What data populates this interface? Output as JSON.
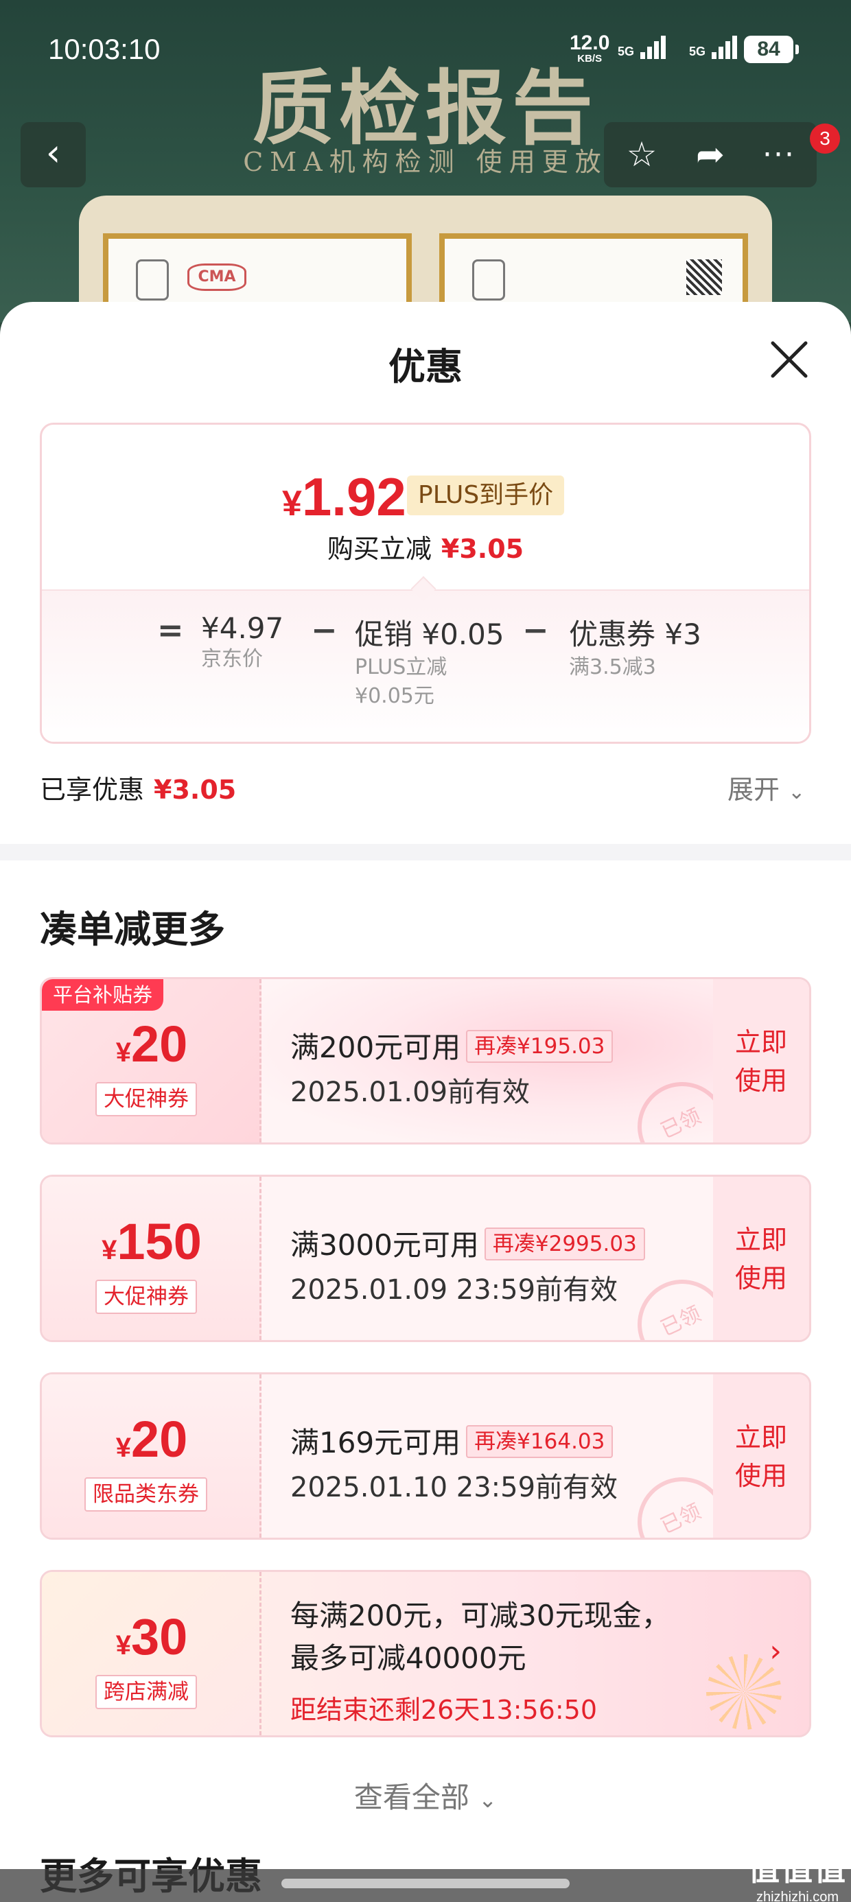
{
  "status_bar": {
    "time": "10:03:10",
    "net_speed": "12.0",
    "net_unit": "KB/S",
    "sig1": "5G",
    "sig2": "5G",
    "battery": "84"
  },
  "banner": {
    "title": "质检报告",
    "subtitle": "CMA机构检测 使用更放",
    "cert_mark": "CMA"
  },
  "nav": {
    "cart_badge": "3"
  },
  "sheet": {
    "title": "优惠"
  },
  "price_card": {
    "currency": "¥",
    "final_price": "1.92",
    "plus_label": "PLUS到手价",
    "instant_label": "购买立减",
    "instant_value": "¥3.05",
    "eq": "=",
    "minus": "−",
    "jd_price": "¥4.97",
    "jd_label": "京东价",
    "promo_value": "促销 ¥0.05",
    "promo_sub1": "PLUS立减",
    "promo_sub2": "¥0.05元",
    "coupon_value": "优惠券 ¥3",
    "coupon_sub": "满3.5减3"
  },
  "enjoyed": {
    "label": "已享优惠",
    "value": "¥3.05",
    "expand": "展开"
  },
  "section": {
    "title": "凑单减更多"
  },
  "coupons": [
    {
      "corner": "平台补贴券",
      "currency": "¥",
      "amount": "20",
      "tag": "大促神券",
      "cond": "满200元可用",
      "chip": "再凑¥195.03",
      "date": "2025.01.09前有效",
      "use": "立即\n使用",
      "stamp": "已领"
    },
    {
      "currency": "¥",
      "amount": "150",
      "tag": "大促神券",
      "cond": "满3000元可用",
      "chip": "再凑¥2995.03",
      "date": "2025.01.09 23:59前有效",
      "use": "立即\n使用",
      "stamp": "已领"
    },
    {
      "currency": "¥",
      "amount": "20",
      "tag": "限品类东券",
      "cond": "满169元可用",
      "chip": "再凑¥164.03",
      "date": "2025.01.10 23:59前有效",
      "use": "立即\n使用",
      "stamp": "已领"
    },
    {
      "currency": "¥",
      "amount": "30",
      "tag": "跨店满减",
      "line1": "每满200元，可减30元现金，",
      "line2": "最多可减40000元",
      "countdown": "距结束还剩26天13:56:50"
    }
  ],
  "see_all": "查看全部",
  "more_title": "更多可享优惠",
  "watermark": {
    "main": "值值值",
    "domain": "zhizhizhi.com"
  }
}
